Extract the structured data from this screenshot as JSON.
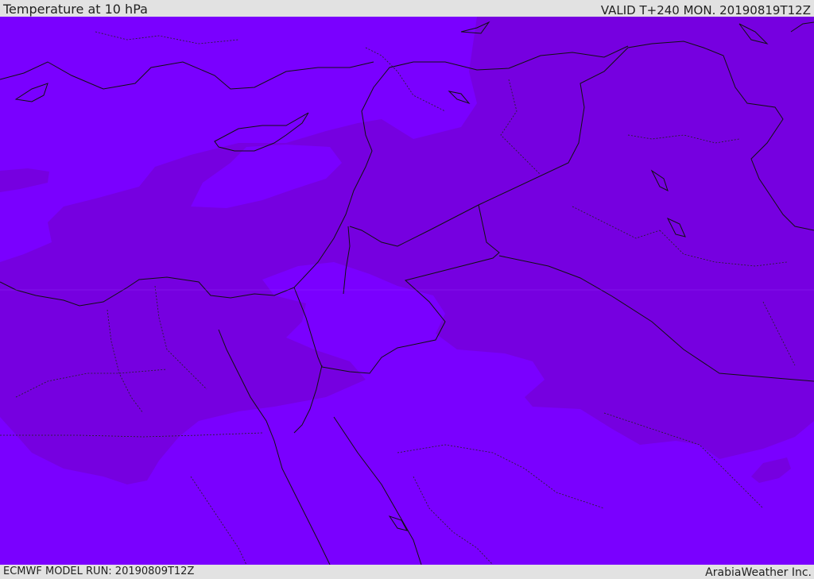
{
  "header": {
    "title": "Temperature at 10 hPa",
    "valid": "VALID T+240 MON. 20190819T12Z"
  },
  "footer": {
    "model_run": "ECMWF MODEL RUN: 20190809T12Z",
    "credit": "ArabiaWeather Inc."
  },
  "colors": {
    "light_band": "#7a00ff",
    "dark_band": "#7600e0",
    "border": "#111111"
  }
}
